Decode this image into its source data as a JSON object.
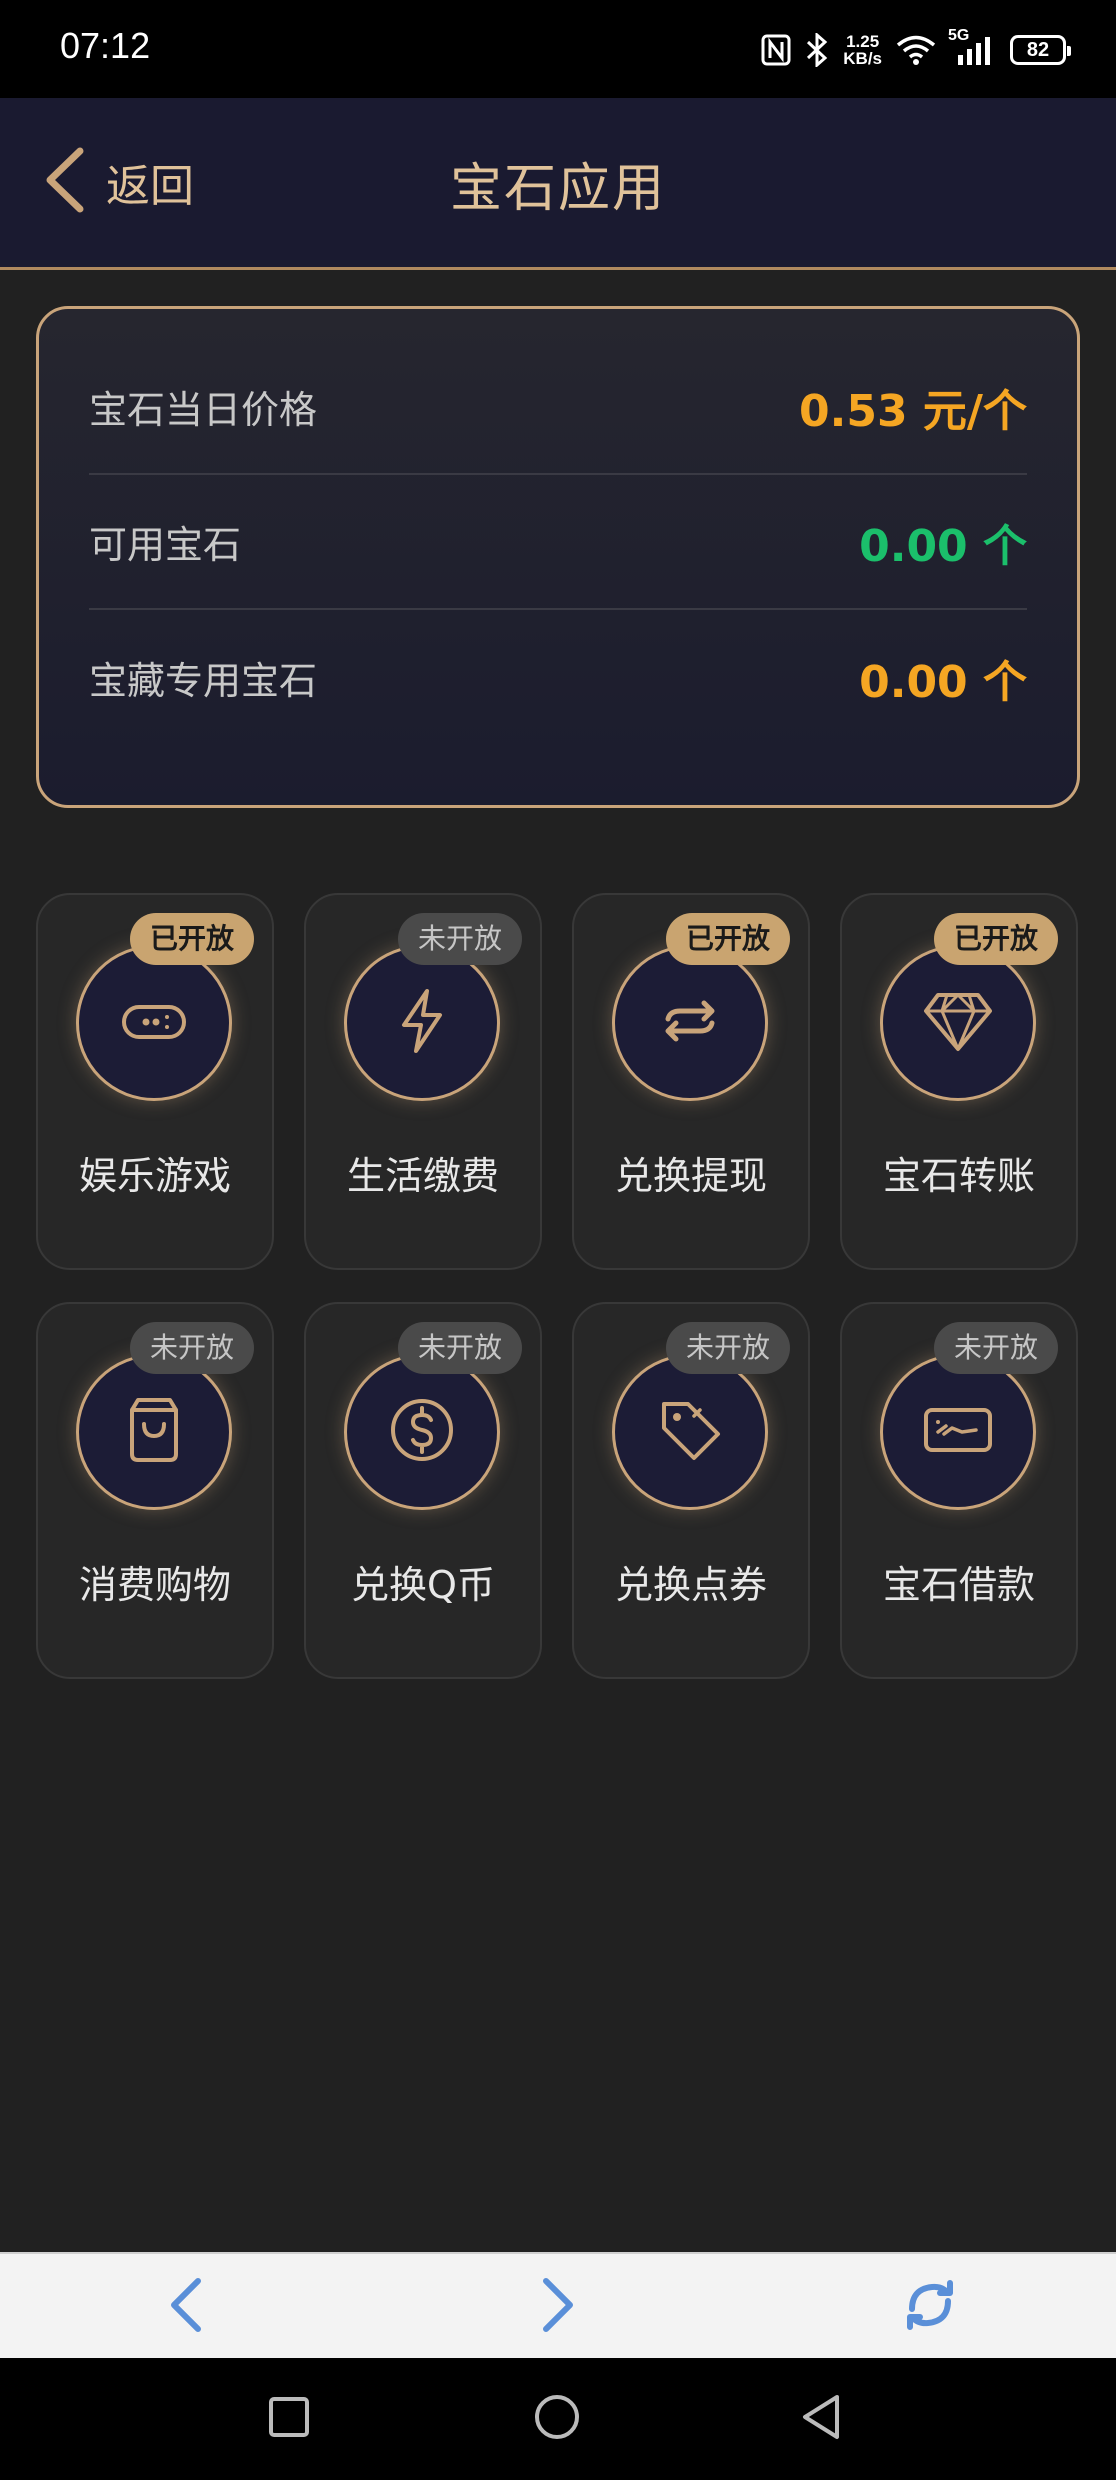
{
  "status_bar": {
    "time": "07:12",
    "net_speed_value": "1.25",
    "net_speed_unit": "KB/s",
    "signal_label": "5G",
    "battery": "82",
    "icons": [
      "nfc-icon",
      "bluetooth-icon",
      "wifi-icon",
      "cell-signal-icon",
      "battery-icon"
    ]
  },
  "header": {
    "back_label": "返回",
    "title": "宝石应用"
  },
  "info_card": {
    "rows": [
      {
        "label": "宝石当日价格",
        "value": "0.53 元/个",
        "color": "#f5a623"
      },
      {
        "label": "可用宝石",
        "value": "0.00 个",
        "color": "#1bbf6b"
      },
      {
        "label": "宝藏专用宝石",
        "value": "0.00 个",
        "color": "#f5a623"
      }
    ]
  },
  "apps": [
    {
      "label": "娱乐游戏",
      "badge": "已开放",
      "open": true,
      "icon": "gamepad-icon"
    },
    {
      "label": "生活缴费",
      "badge": "未开放",
      "open": false,
      "icon": "lightning-icon"
    },
    {
      "label": "兑换提现",
      "badge": "已开放",
      "open": true,
      "icon": "exchange-icon"
    },
    {
      "label": "宝石转账",
      "badge": "已开放",
      "open": true,
      "icon": "diamond-icon"
    },
    {
      "label": "消费购物",
      "badge": "未开放",
      "open": false,
      "icon": "shopping-bag-icon"
    },
    {
      "label": "兑换Q币",
      "badge": "未开放",
      "open": false,
      "icon": "dollar-coin-icon"
    },
    {
      "label": "兑换点券",
      "badge": "未开放",
      "open": false,
      "icon": "tag-icon"
    },
    {
      "label": "宝石借款",
      "badge": "未开放",
      "open": false,
      "icon": "card-icon"
    }
  ],
  "colors": {
    "accent_gold": "#c9a47a",
    "header_bg": "#1a1a30",
    "page_bg": "#212121",
    "browser_nav_blue": "#5a8fd8"
  },
  "browser_nav": {
    "buttons": [
      "back-arrow-icon",
      "forward-arrow-icon",
      "refresh-icon"
    ]
  },
  "system_nav": {
    "buttons": [
      "recents-square-icon",
      "home-circle-icon",
      "back-triangle-icon"
    ]
  }
}
